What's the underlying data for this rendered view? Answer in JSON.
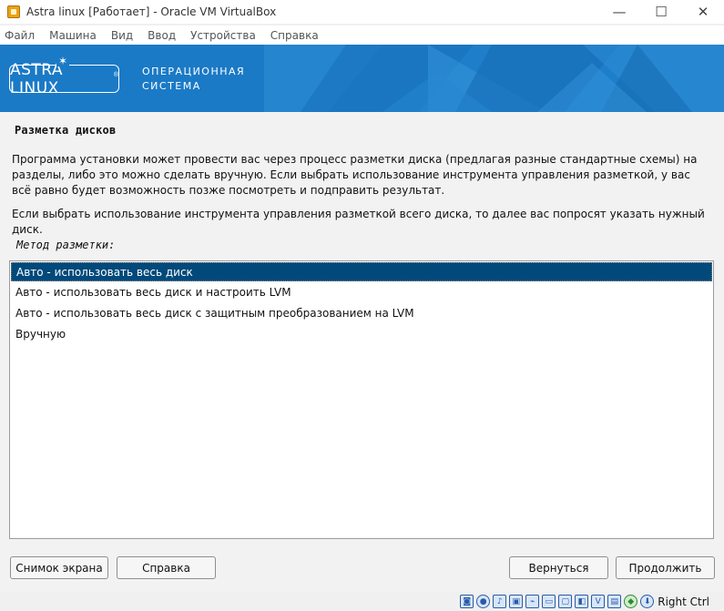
{
  "window": {
    "title": "Astra linux [Работает] - Oracle VM VirtualBox",
    "minimize": "—",
    "maximize": "☐",
    "close": "✕"
  },
  "menu": {
    "items": [
      "Файл",
      "Машина",
      "Вид",
      "Ввод",
      "Устройства",
      "Справка"
    ]
  },
  "banner": {
    "logo": "ASTRA LINUX",
    "logo_mark": "®",
    "subtitle_line1": "ОПЕРАЦИОННАЯ",
    "subtitle_line2": "СИСТЕМА"
  },
  "installer": {
    "heading": "Разметка дисков",
    "paragraph1": "Программа установки может провести вас через процесс разметки диска (предлагая разные стандартные схемы) на разделы, либо это можно сделать вручную. Если выбрать использование инструмента управления разметкой, у вас всё равно будет возможность позже посмотреть и подправить результат.",
    "paragraph2": "Если выбрать использование инструмента управления разметкой всего диска, то далее вас попросят указать нужный диск.",
    "method_label": "Метод разметки:",
    "options": [
      "Авто - использовать весь диск",
      "Авто - использовать весь диск и настроить LVM",
      "Авто - использовать весь диск с защитным преобразованием на LVM",
      "Вручную"
    ],
    "selected_index": 0
  },
  "buttons": {
    "screenshot": "Снимок экрана",
    "help": "Справка",
    "back": "Вернуться",
    "continue": "Продолжить"
  },
  "statusbar": {
    "host_key": "Right Ctrl",
    "icons": [
      "hdd-icon",
      "optical-icon",
      "audio-icon",
      "network-icon",
      "usb-icon",
      "shared-folder-icon",
      "display-icon",
      "recording-icon",
      "cpu-icon",
      "mouse-icon",
      "keyboard-icon",
      "arrow-down-icon"
    ]
  },
  "colors": {
    "banner_blue": "#1f7ec9",
    "selection": "#00497a"
  }
}
